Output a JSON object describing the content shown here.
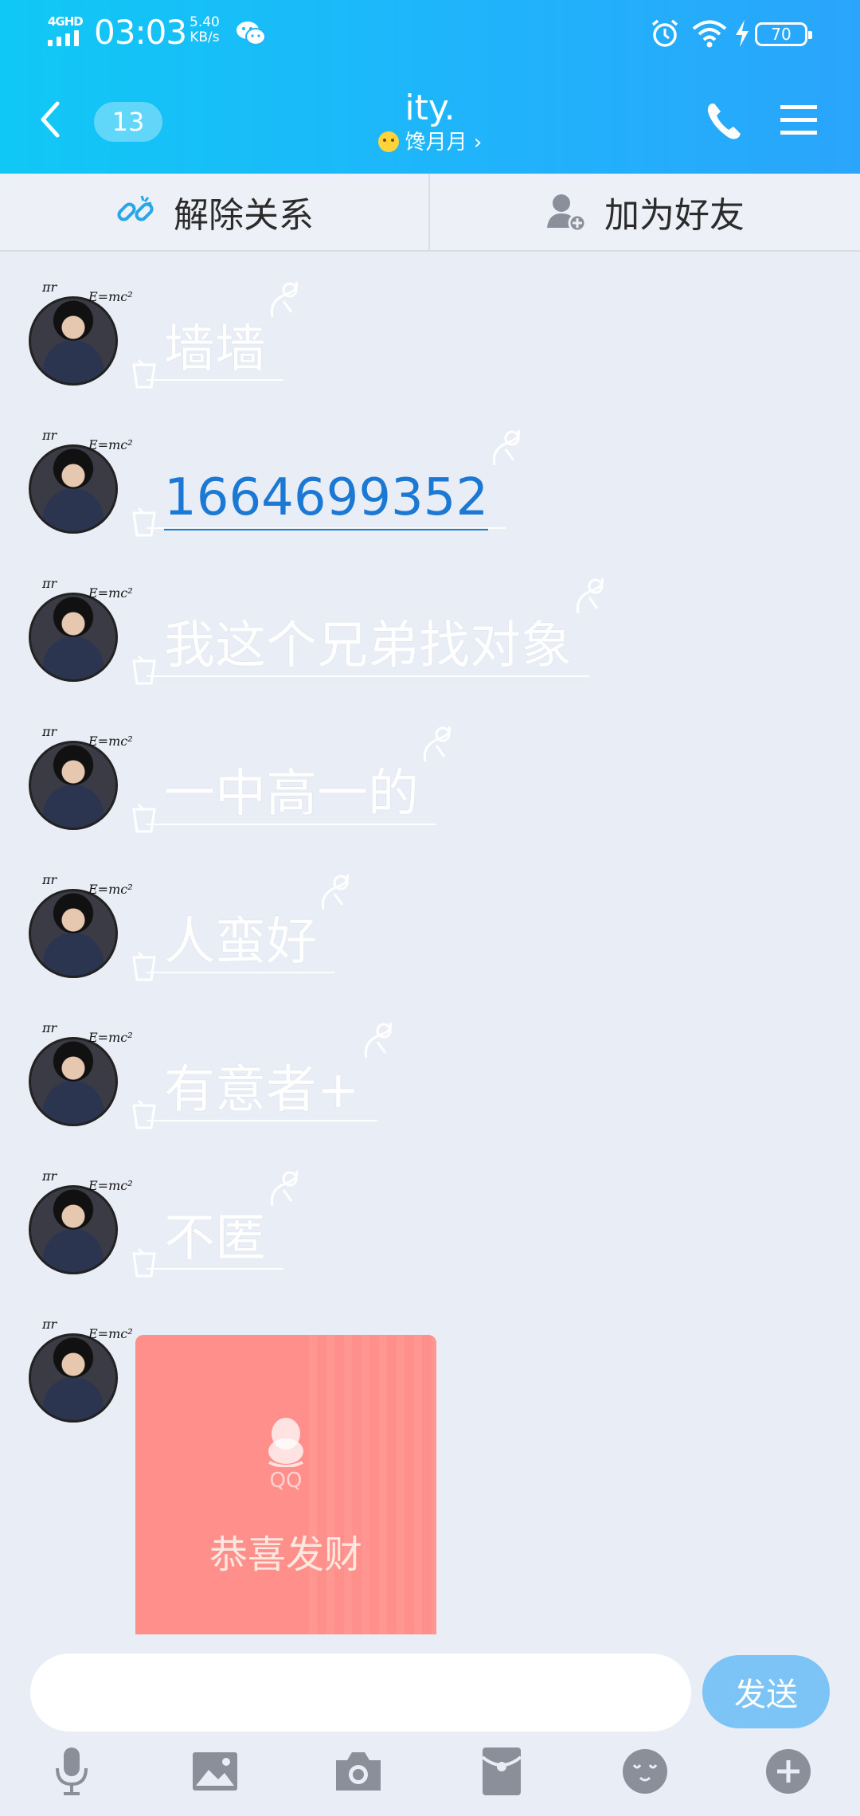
{
  "status_bar": {
    "network": "4GHD",
    "time": "03:03",
    "speed_value": "5.40",
    "speed_unit": "KB/s",
    "battery": "70"
  },
  "header": {
    "unread_count": "13",
    "title": "ity.",
    "subtitle": "馋月月 ›"
  },
  "actions": {
    "unlink_label": "解除关系",
    "add_friend_label": "加为好友"
  },
  "messages": [
    {
      "text": "墙墙"
    },
    {
      "text": "1664699352"
    },
    {
      "text": "我这个兄弟找对象"
    },
    {
      "text": "一中高一的"
    },
    {
      "text": "人蛮好"
    },
    {
      "text": "有意者+"
    },
    {
      "text": "不匿"
    }
  ],
  "red_packet": {
    "brand": "QQ",
    "wish": "恭喜发财"
  },
  "composer": {
    "value": "",
    "send_label": "发送"
  },
  "colors": {
    "header_start": "#10c8f5",
    "header_end": "#2aa5fb",
    "link": "#1b78d3",
    "send_button": "#7cc3f6",
    "red_packet": "#ff8f8b"
  }
}
